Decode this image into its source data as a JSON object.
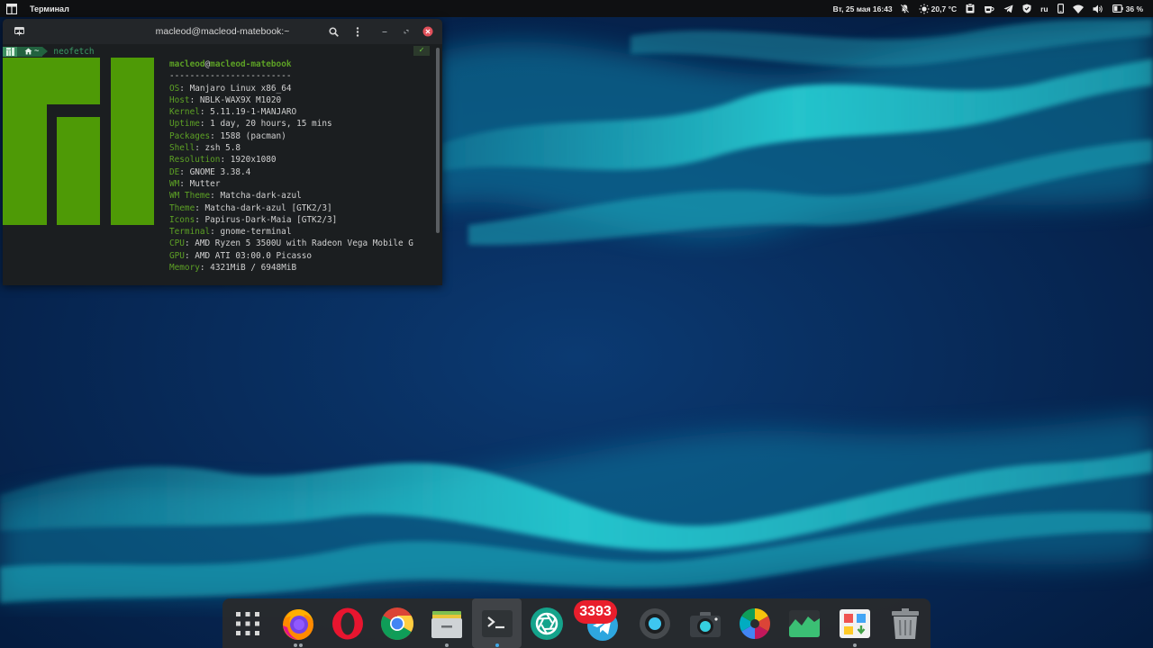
{
  "topbar": {
    "app_menu_title": "Терминал",
    "datetime": "Вт, 25 мая 16:43",
    "weather_temp": "20,7 °C",
    "keyboard_layout": "ru",
    "battery_percent": "36 %",
    "icons": [
      "apps-icon",
      "notifications-off-icon",
      "weather-icon",
      "clipboard-icon",
      "coffee-icon",
      "telegram-icon",
      "vpn-shield-icon",
      "phone-icon",
      "wifi-icon",
      "volume-icon",
      "battery-icon"
    ]
  },
  "terminal": {
    "title": "macleod@macleod-matebook:~",
    "prompt": {
      "home_segment": "~",
      "command": "neofetch",
      "status": "✓"
    },
    "neofetch": {
      "user": "macleod",
      "at": "@",
      "host": "macleod-matebook",
      "separator": "------------------------",
      "lines": [
        {
          "key": "OS",
          "value": "Manjaro Linux x86_64"
        },
        {
          "key": "Host",
          "value": "NBLK-WAX9X M1020"
        },
        {
          "key": "Kernel",
          "value": "5.11.19-1-MANJARO"
        },
        {
          "key": "Uptime",
          "value": "1 day, 20 hours, 15 mins"
        },
        {
          "key": "Packages",
          "value": "1588 (pacman)"
        },
        {
          "key": "Shell",
          "value": "zsh 5.8"
        },
        {
          "key": "Resolution",
          "value": "1920x1080"
        },
        {
          "key": "DE",
          "value": "GNOME 3.38.4"
        },
        {
          "key": "WM",
          "value": "Mutter"
        },
        {
          "key": "WM Theme",
          "value": "Matcha-dark-azul"
        },
        {
          "key": "Theme",
          "value": "Matcha-dark-azul [GTK2/3]"
        },
        {
          "key": "Icons",
          "value": "Papirus-Dark-Maia [GTK2/3]"
        },
        {
          "key": "Terminal",
          "value": "gnome-terminal"
        },
        {
          "key": "CPU",
          "value": "AMD Ryzen 5 3500U with Radeon Vega Mobile G"
        },
        {
          "key": "GPU",
          "value": "AMD ATI 03:00.0 Picasso"
        },
        {
          "key": "Memory",
          "value": "4321MiB / 6948MiB"
        }
      ]
    }
  },
  "dock": {
    "items": [
      {
        "name": "show-applications",
        "running": false
      },
      {
        "name": "firefox",
        "running": true
      },
      {
        "name": "opera",
        "running": false
      },
      {
        "name": "chrome",
        "running": false
      },
      {
        "name": "file-manager",
        "running": true
      },
      {
        "name": "terminal",
        "running": true,
        "active": true
      },
      {
        "name": "aperture",
        "running": false
      },
      {
        "name": "telegram",
        "running": false,
        "badge": "3393"
      },
      {
        "name": "obs",
        "running": false
      },
      {
        "name": "screenshot",
        "running": false
      },
      {
        "name": "color-picker",
        "running": false
      },
      {
        "name": "system-monitor",
        "running": false
      },
      {
        "name": "software-center",
        "running": true
      },
      {
        "name": "trash",
        "running": false
      }
    ]
  },
  "colors": {
    "topbar_bg": "#0f1012",
    "terminal_bg": "#1b1e20",
    "neofetch_key": "#5da125",
    "manjaro_logo": "#4e9a06",
    "wave_cyan": "#29d3d8",
    "desktop_blue": "#04183a",
    "badge_red": "#e91e2c"
  }
}
